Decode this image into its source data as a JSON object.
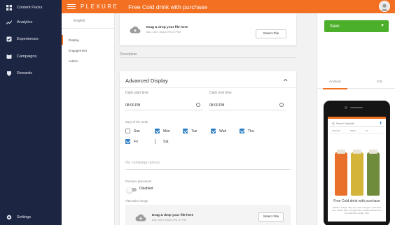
{
  "sidebar": {
    "items": [
      {
        "label": "Content Packs",
        "icon": "grid-icon"
      },
      {
        "label": "Analytics",
        "icon": "trend-icon"
      },
      {
        "label": "Experiences",
        "icon": "check-doc-icon"
      },
      {
        "label": "Campaigns",
        "icon": "campaign-icon"
      },
      {
        "label": "Rewards",
        "icon": "gift-icon"
      }
    ],
    "settings_label": "Settings"
  },
  "topbar": {
    "brand": "PLEXURE",
    "title": "Free Cold drink with purchase",
    "color": "#f36f21"
  },
  "subnav": {
    "language_tab": "English",
    "items": [
      "Display",
      "Engagement",
      "Admin"
    ]
  },
  "upload_top": {
    "main": "Drag & drop your file here",
    "sub": "Max. 500 x 500px JPG or PNG",
    "button": "Select File"
  },
  "description": {
    "label": "Description"
  },
  "advanced": {
    "title": "Advanced Display",
    "start_label": "Daily start time",
    "start_value": "08:00 PM",
    "end_label": "Daily end time",
    "end_value": "08:00 PM",
    "days_label": "Days of the week",
    "days": [
      {
        "label": "Sun",
        "checked": false
      },
      {
        "label": "Mon",
        "checked": true
      },
      {
        "label": "Tue",
        "checked": true
      },
      {
        "label": "Wed",
        "checked": true
      },
      {
        "label": "Thu",
        "checked": true
      },
      {
        "label": "Fri",
        "checked": true
      },
      {
        "label": "Sat",
        "checked": false
      }
    ],
    "campaign_group": "No campaign group",
    "premium_label": "Premium placement",
    "premium_value": "Disabled",
    "alt_image_label": "Alternative image",
    "upload_main": "Drag & drop your file here",
    "upload_sub": "Max. 500 x 500px JPG or PNG",
    "upload_button": "Select File"
  },
  "right": {
    "save_label": "Save",
    "save_color": "#4caf2a",
    "tabs": [
      "Android",
      "iOS"
    ],
    "preview": {
      "search_placeholder": "Search Specials",
      "chips": [
        "Featured",
        "Offers",
        "All"
      ],
      "offer_title": "Free Cold drink with purchase",
      "offer_desc": "Valid for 2 days. Buy any main and get a cold drink free. Select from a range of the creative drinks from the cold drink range. T&C"
    }
  }
}
